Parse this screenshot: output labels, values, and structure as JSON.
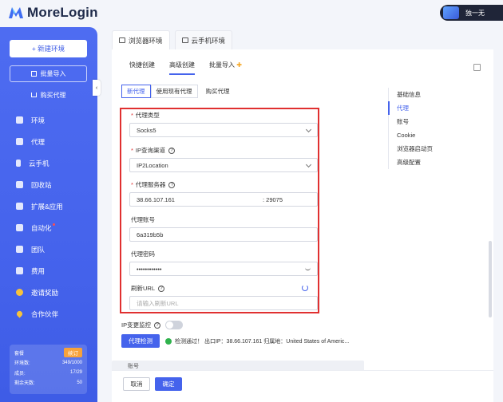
{
  "app": {
    "logo_text": "MoreLogin",
    "user_name": "独一无"
  },
  "sidebar": {
    "new_env": "+ 新建环境",
    "batch_import": "批量导入",
    "buy_proxy": "购买代理",
    "items": [
      {
        "label": "环境",
        "icon": "monitor-icon"
      },
      {
        "label": "代理",
        "icon": "list-icon"
      },
      {
        "label": "云手机",
        "icon": "phone-icon"
      },
      {
        "label": "回收站",
        "icon": "trash-icon"
      },
      {
        "label": "扩展&应用",
        "icon": "puzzle-icon"
      },
      {
        "label": "自动化",
        "icon": "robot-icon"
      },
      {
        "label": "团队",
        "icon": "team-icon"
      },
      {
        "label": "费用",
        "icon": "bill-icon"
      },
      {
        "label": "邀请奖励",
        "icon": "gift-icon"
      },
      {
        "label": "合作伙伴",
        "icon": "heart-icon"
      }
    ],
    "stats": {
      "plan_label": "套餐",
      "renew": "续订",
      "env_label": "环境数:",
      "env_value": "349/1000",
      "member_label": "成员:",
      "member_value": "17/29",
      "days_label": "剩余天数:",
      "days_value": "50"
    }
  },
  "tabs": [
    {
      "label": "浏览器环境",
      "active": true
    },
    {
      "label": "云手机环境",
      "active": false
    }
  ],
  "subtabs": {
    "quick": "快捷创建",
    "advanced": "高级创建",
    "batch": "批量导入"
  },
  "proxy_tabs": {
    "new_proxy": "新代理",
    "use_existing": "使用现有代理",
    "buy_proxy": "购买代理"
  },
  "form": {
    "proxy_type_label": "代理类型",
    "proxy_type_value": "Socks5",
    "ip_channel_label": "IP查询渠道",
    "ip_channel_value": "IP2Location",
    "server_label": "代理服务器",
    "server_host": "38.66.107.161",
    "server_port": ": 29075",
    "account_label": "代理账号",
    "account_value": "6a319b5b",
    "password_label": "代理密码",
    "password_value": "••••••••••••",
    "refresh_url_label": "刷新URL",
    "refresh_url_placeholder": "请输入刷新URL",
    "ip_monitor_label": "IP变更监控",
    "detect_button": "代理检测",
    "detect_result": "检测通过！ 出口IP：38.66.107.161 归属地：United States of Americ..."
  },
  "collapsed_section": "账号",
  "footer": {
    "cancel": "取消",
    "confirm": "确定"
  },
  "right_nav": [
    {
      "label": "基础信息",
      "active": false
    },
    {
      "label": "代理",
      "active": true
    },
    {
      "label": "账号",
      "active": false
    },
    {
      "label": "Cookie",
      "active": false
    },
    {
      "label": "浏览器启动页",
      "active": false
    },
    {
      "label": "高级配置",
      "active": false
    }
  ],
  "colors": {
    "accent": "#4563ec",
    "sidebar": "#4e6cf1",
    "highlight_box": "#e03030",
    "success": "#2fb24c",
    "renew": "#f7a23b"
  }
}
